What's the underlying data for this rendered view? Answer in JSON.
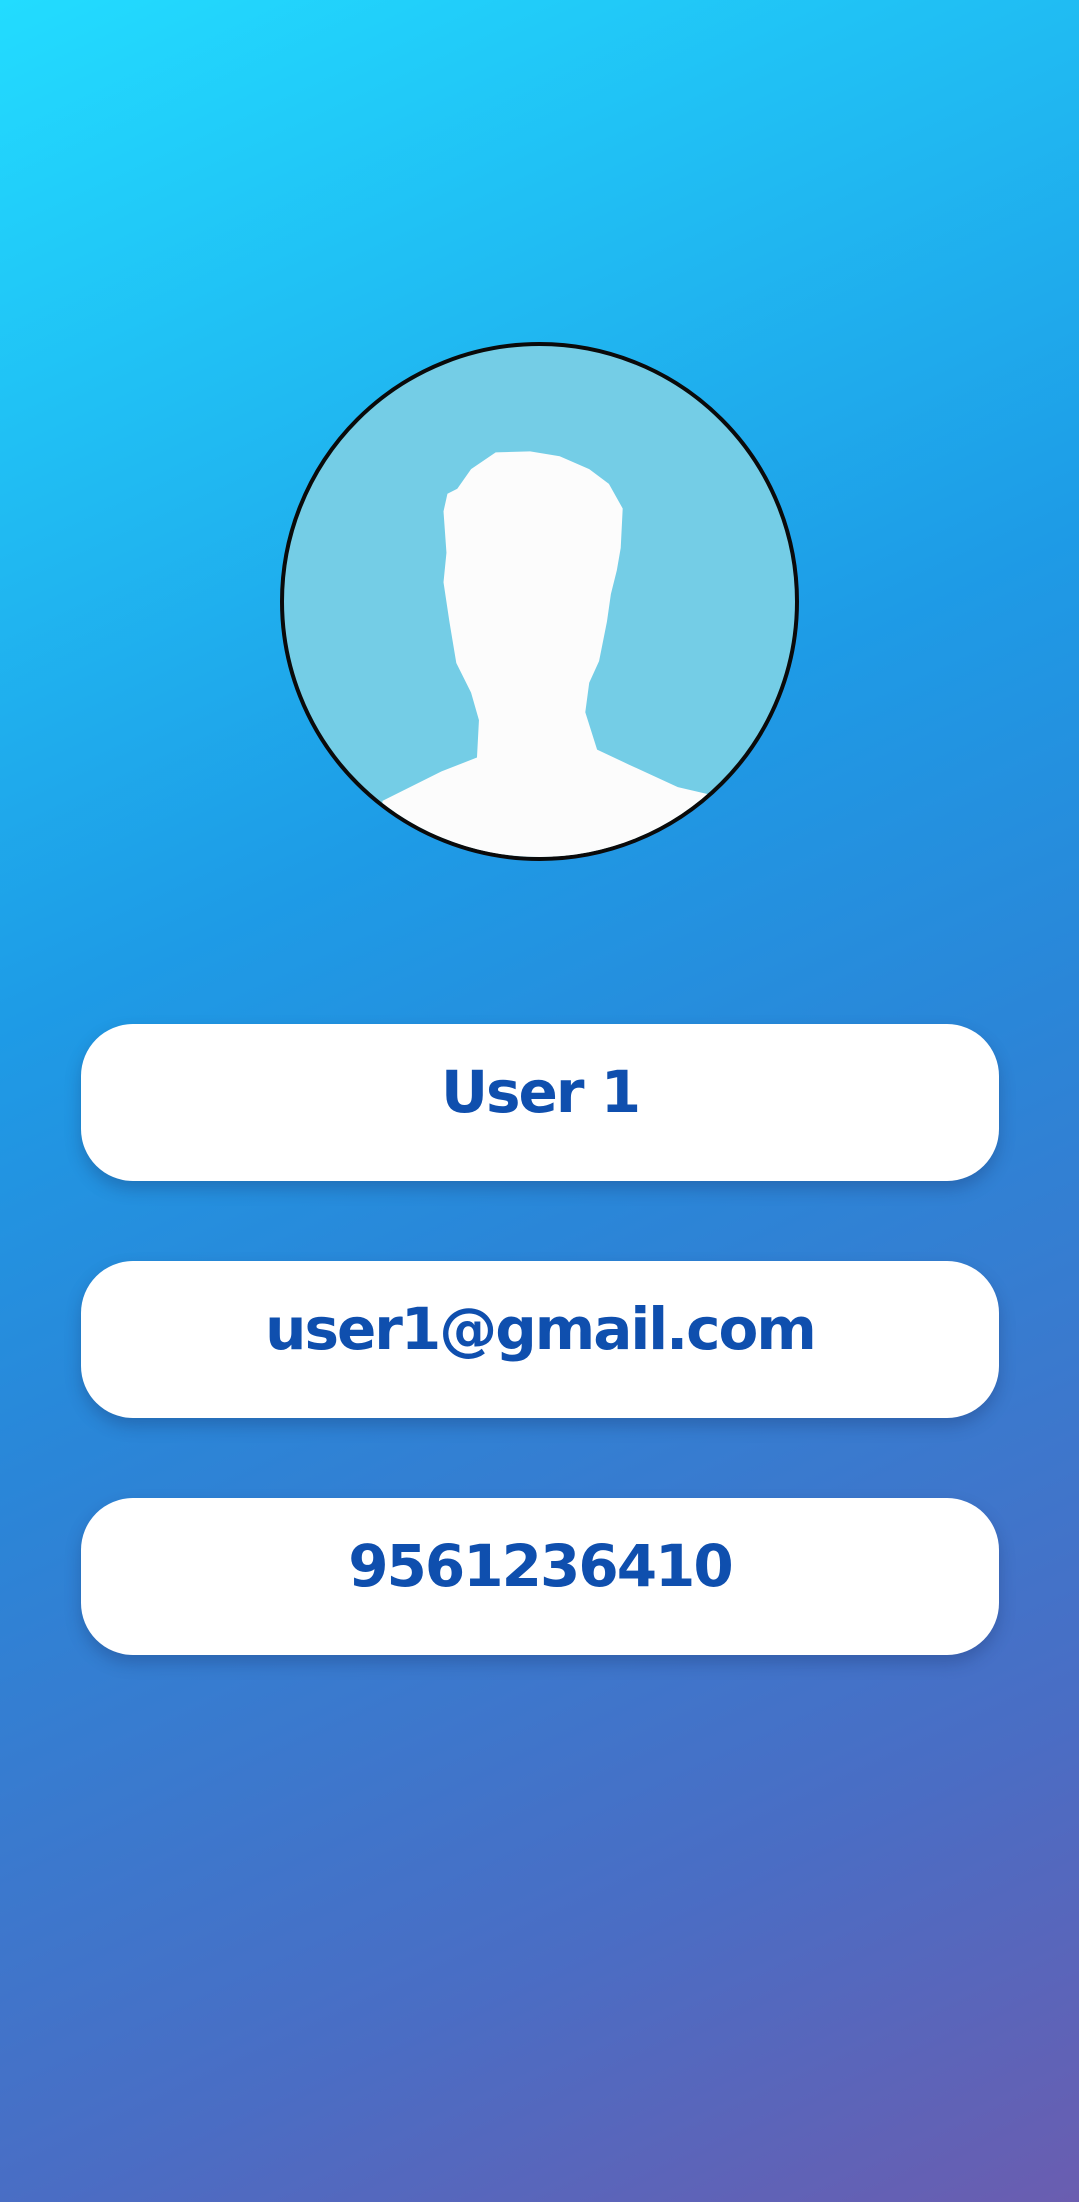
{
  "profile": {
    "avatar_icon": "user-silhouette-icon",
    "name": "User 1",
    "email": "user1@gmail.com",
    "phone": "9561236410"
  },
  "colors": {
    "background_start": "#22dcff",
    "background_end": "#6a5db0",
    "avatar_bg": "#74cde6",
    "text": "#0f4fae",
    "card": "#ffffff"
  }
}
